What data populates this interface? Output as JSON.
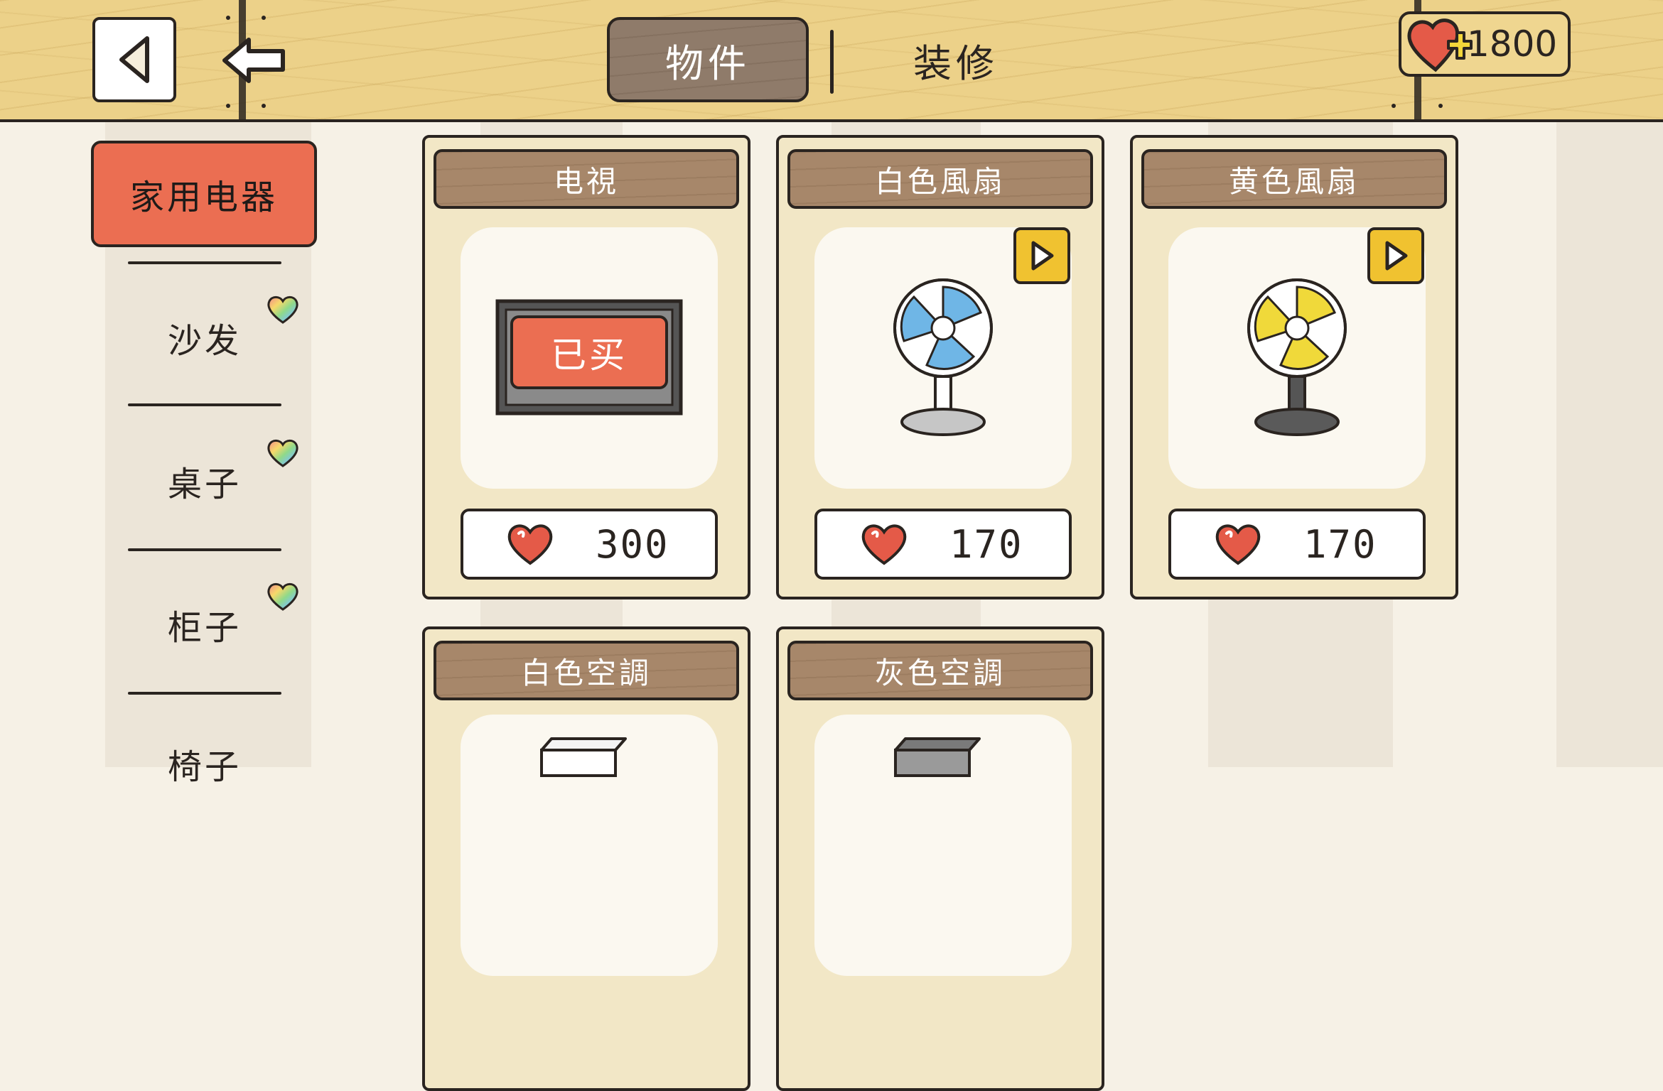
{
  "header": {
    "tabs": [
      {
        "label": "物件",
        "active": true
      },
      {
        "label": "装修",
        "active": false
      }
    ],
    "currency_value": "1800",
    "icons": [
      "back-icon",
      "exit-arrow-icon",
      "heart-plus-icon"
    ]
  },
  "sidebar": {
    "active": "家用电器",
    "items": [
      {
        "label": "沙发",
        "badge": "rainbow-heart-icon"
      },
      {
        "label": "桌子",
        "badge": "rainbow-heart-icon"
      },
      {
        "label": "柜子",
        "badge": "rainbow-heart-icon"
      },
      {
        "label": "椅子",
        "badge": ""
      }
    ]
  },
  "items": [
    {
      "name": "电視",
      "price": "300",
      "status": "已买",
      "video_unlock": false,
      "image": "tv"
    },
    {
      "name": "白色風扇",
      "price": "170",
      "status": "",
      "video_unlock": true,
      "image": "fan-blue"
    },
    {
      "name": "黄色風扇",
      "price": "170",
      "status": "",
      "video_unlock": true,
      "image": "fan-yellow"
    },
    {
      "name": "白色空調",
      "price": "",
      "status": "",
      "video_unlock": false,
      "image": "ac-white"
    },
    {
      "name": "灰色空調",
      "price": "",
      "status": "",
      "video_unlock": false,
      "image": "ac-gray"
    }
  ],
  "colors": {
    "accent": "#eb6e52",
    "wood": "#ecd189",
    "card": "#f2e7c6",
    "ad": "#f0c230"
  }
}
